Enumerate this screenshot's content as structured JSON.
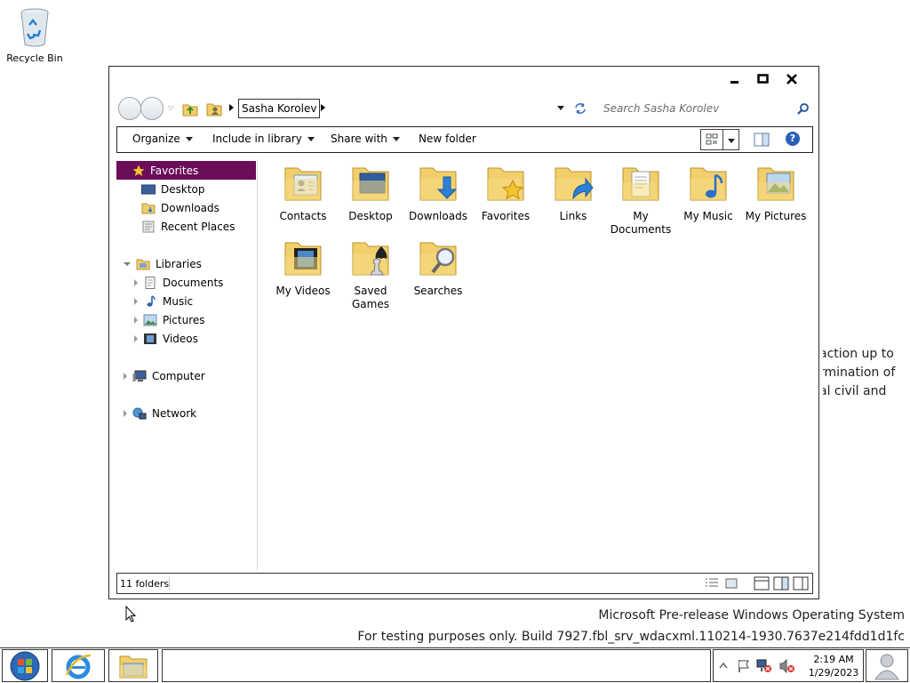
{
  "desktop": {
    "recycle_bin_label": "Recycle Bin",
    "background_text_lines": [
      "action up to",
      "rmination of",
      "al civil and"
    ],
    "watermark_line1": "Microsoft Pre-release Windows Operating System",
    "watermark_line2": "For testing purposes only. Build 7927.fbl_srv_wdacxml.110214-1930.7637e214fdd1d1fc"
  },
  "window": {
    "caption_buttons": [
      "minimize",
      "maximize",
      "close"
    ],
    "address": {
      "breadcrumb": "Sasha Korolev",
      "search_placeholder": "Search Sasha Korolev"
    },
    "toolbar": {
      "organize": "Organize",
      "include_in_library": "Include in library",
      "share_with": "Share with",
      "new_folder": "New folder"
    },
    "nav": {
      "favorites": "Favorites",
      "desktop": "Desktop",
      "downloads": "Downloads",
      "recent_places": "Recent Places",
      "libraries": "Libraries",
      "documents": "Documents",
      "music": "Music",
      "pictures": "Pictures",
      "videos": "Videos",
      "computer": "Computer",
      "network": "Network"
    },
    "folders": [
      {
        "label": "Contacts"
      },
      {
        "label": "Desktop"
      },
      {
        "label": "Downloads"
      },
      {
        "label": "Favorites"
      },
      {
        "label": "Links"
      },
      {
        "label": "My Documents"
      },
      {
        "label": "My Music"
      },
      {
        "label": "My Pictures"
      },
      {
        "label": "My Videos"
      },
      {
        "label": "Saved Games"
      },
      {
        "label": "Searches"
      }
    ],
    "status": {
      "count": "11 folders"
    }
  },
  "taskbar": {
    "clock_time": "2:19 AM",
    "clock_date": "1/29/2023"
  },
  "colors": {
    "selection": "#6b0d59",
    "folder_yellow": "#f2cf6a"
  }
}
